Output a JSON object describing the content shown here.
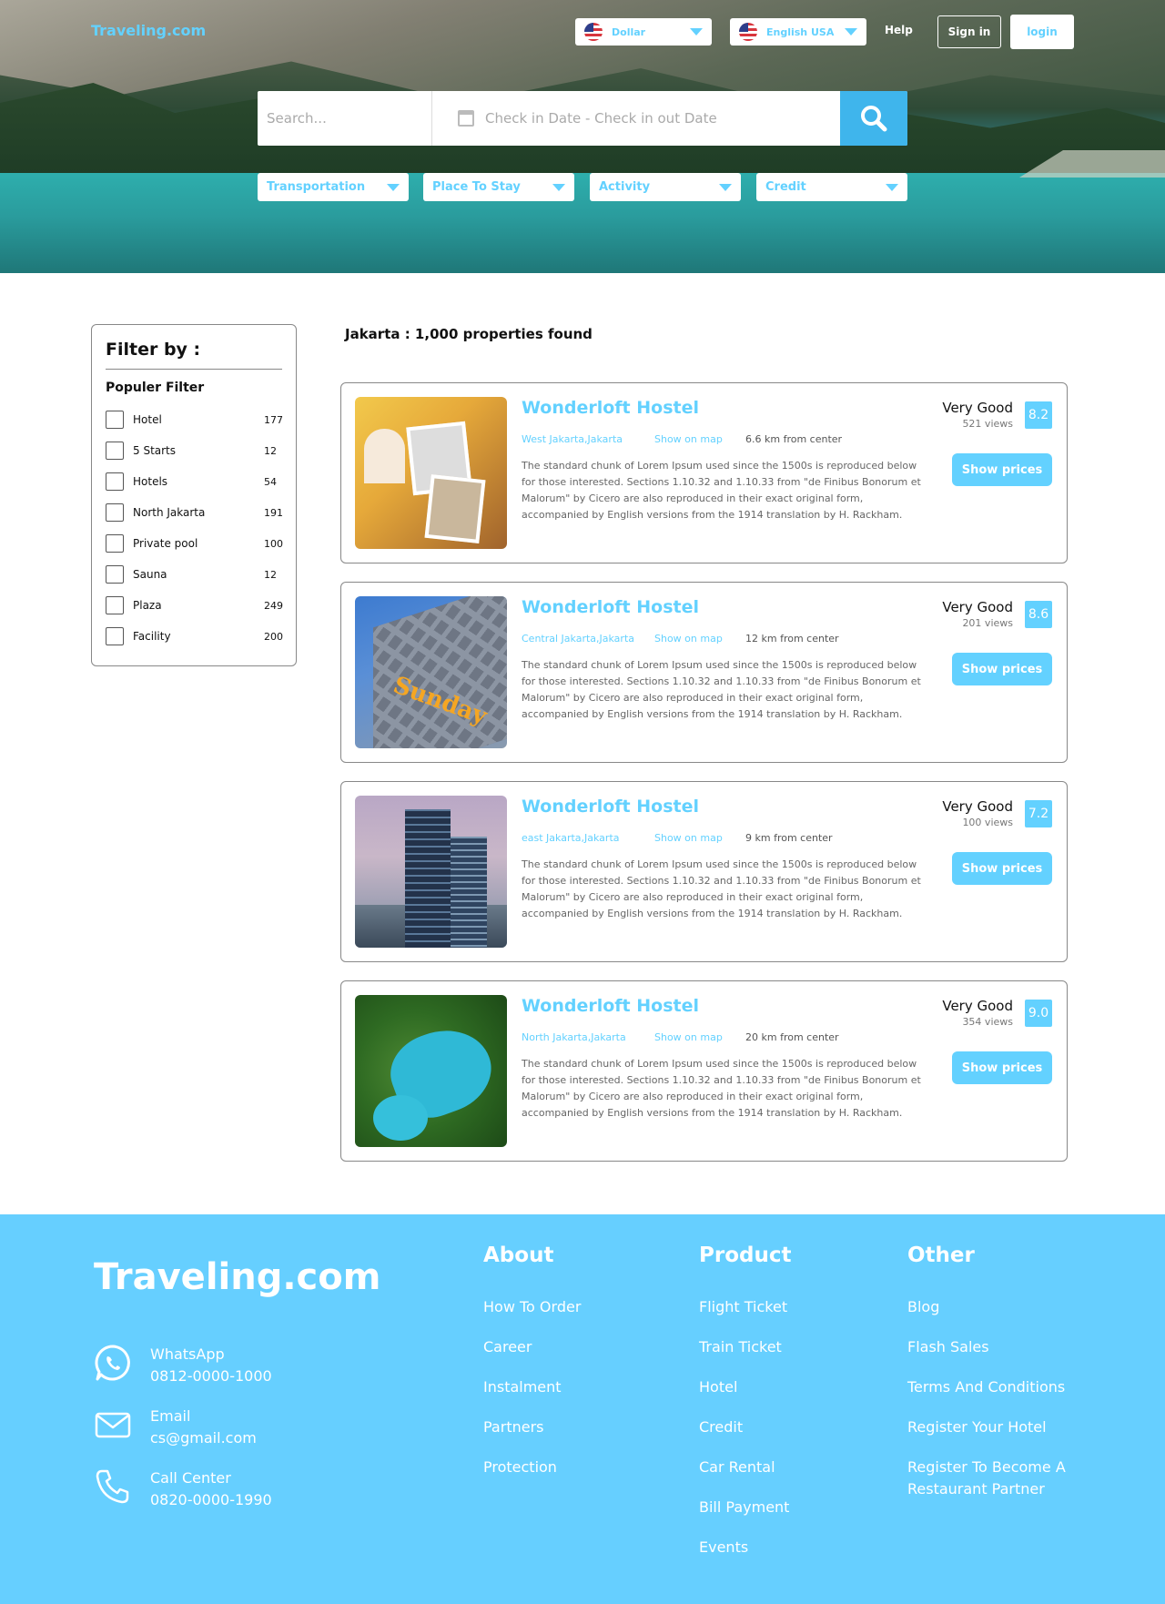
{
  "nav": {
    "logo": "Traveling.com",
    "currency": "Dollar",
    "language": "English USA",
    "help": "Help",
    "sign_in": "Sign in",
    "login": "login"
  },
  "search": {
    "placeholder": "Search...",
    "date_placeholder": "Check in Date - Check in out Date"
  },
  "dropdowns": [
    "Transportation",
    "Place To Stay",
    "Activity",
    "Credit"
  ],
  "filter": {
    "title": "Filter by :",
    "subtitle": "Populer Filter",
    "items": [
      {
        "label": "Hotel",
        "count": "177"
      },
      {
        "label": "5 Starts",
        "count": "12"
      },
      {
        "label": "Hotels",
        "count": "54"
      },
      {
        "label": "North Jakarta",
        "count": "191"
      },
      {
        "label": "Private pool",
        "count": "100"
      },
      {
        "label": "Sauna",
        "count": "12"
      },
      {
        "label": "Plaza",
        "count": "249"
      },
      {
        "label": "Facility",
        "count": "200"
      }
    ]
  },
  "results_title": "Jakarta :  1,000 properties found",
  "listings": [
    {
      "name": "Wonderloft Hostel",
      "location": "West Jakarta,Jakarta",
      "map": "Show on map",
      "distance": "6.6 km from center",
      "description": "The standard chunk of Lorem Ipsum used since the 1500s is reproduced below for those interested. Sections 1.10.32 and 1.10.33 from \"de Finibus Bonorum et Malorum\" by Cicero are also reproduced in their exact original form, accompanied by English versions from the 1914 translation by H. Rackham.",
      "rating_text": "Very Good",
      "views": "521 views",
      "score": "8.2",
      "button": "Show prices"
    },
    {
      "name": "Wonderloft Hostel",
      "location": "Central Jakarta,Jakarta",
      "map": "Show on map",
      "distance": "12 km from center",
      "description": "The standard chunk of Lorem Ipsum used since the 1500s is reproduced below for those interested. Sections 1.10.32 and 1.10.33 from \"de Finibus Bonorum et Malorum\" by Cicero are also reproduced in their exact original form, accompanied by English versions from the 1914 translation by H. Rackham.",
      "rating_text": "Very Good",
      "views": "201 views",
      "score": "8.6",
      "button": "Show prices"
    },
    {
      "name": "Wonderloft Hostel",
      "location": "east Jakarta,Jakarta",
      "map": "Show on map",
      "distance": "9 km from center",
      "description": "The standard chunk of Lorem Ipsum used since the 1500s is reproduced below for those interested. Sections 1.10.32 and 1.10.33 from \"de Finibus Bonorum et Malorum\" by Cicero are also reproduced in their exact original form, accompanied by English versions from the 1914 translation by H. Rackham.",
      "rating_text": "Very Good",
      "views": "100 views",
      "score": "7.2",
      "button": "Show prices"
    },
    {
      "name": "Wonderloft Hostel",
      "location": "North Jakarta,Jakarta",
      "map": "Show on map",
      "distance": "20 km from center",
      "description": "The standard chunk of Lorem Ipsum used since the 1500s is reproduced below for those interested. Sections 1.10.32 and 1.10.33 from \"de Finibus Bonorum et Malorum\" by Cicero are also reproduced in their exact original form, accompanied by English versions from the 1914 translation by H. Rackham.",
      "rating_text": "Very Good",
      "views": "354 views",
      "score": "9.0",
      "button": "Show prices"
    }
  ],
  "footer": {
    "logo": "Traveling.com",
    "contacts": [
      {
        "icon": "whatsapp-icon",
        "label": "WhatsApp",
        "value": "0812-0000-1000"
      },
      {
        "icon": "mail-icon",
        "label": "Email",
        "value": "cs@gmail.com"
      },
      {
        "icon": "phone-icon",
        "label": "Call Center",
        "value": "0820-0000-1990"
      }
    ],
    "columns": [
      {
        "title": "About",
        "links": [
          "How To Order",
          "Career",
          "Instalment",
          "Partners",
          "Protection"
        ]
      },
      {
        "title": "Product",
        "links": [
          "Flight Ticket",
          "Train Ticket",
          "Hotel",
          "Credit",
          "Car Rental",
          "Bill Payment",
          "Events"
        ]
      },
      {
        "title": "Other",
        "links": [
          "Blog",
          "Flash Sales",
          "Terms And Conditions",
          "Register Your Hotel",
          "Register To Become A Restaurant Partner"
        ]
      }
    ]
  },
  "colors": {
    "accent": "#63d1ff",
    "footer_bg": "#66cfff",
    "search_button": "#3fb5ec"
  }
}
